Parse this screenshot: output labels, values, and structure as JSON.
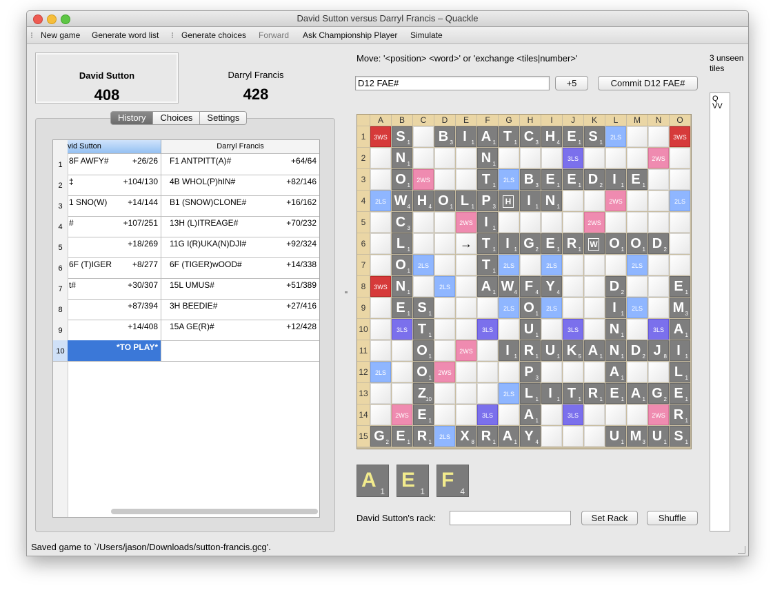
{
  "window": {
    "title": "David Sutton versus Darryl Francis – Quackle"
  },
  "toolbar": {
    "new_game": "New game",
    "generate_word_list": "Generate word list",
    "generate_choices": "Generate choices",
    "forward": "Forward",
    "ask_championship": "Ask Championship Player",
    "simulate": "Simulate"
  },
  "players": [
    {
      "name": "David Sutton",
      "score": "408"
    },
    {
      "name": "Darryl Francis",
      "score": "428"
    }
  ],
  "tabs": [
    "History",
    "Choices",
    "Settings"
  ],
  "history": {
    "columns": [
      "vid Sutton",
      "Darryl Francis"
    ],
    "rows": [
      {
        "n": "1",
        "a_move": "8F AWFY#",
        "a_score": "+26/26",
        "b_move": "F1 ANTPITT(A)#",
        "b_score": "+64/64"
      },
      {
        "n": "2",
        "a_move": "‡",
        "a_score": "+104/130",
        "b_move": "4B WHOL(P)hIN#",
        "b_score": "+82/146"
      },
      {
        "n": "3",
        "a_move": "1 SNO(W)",
        "a_score": "+14/144",
        "b_move": "B1 (SNOW)CLONE#",
        "b_score": "+16/162"
      },
      {
        "n": "4",
        "a_move": "#",
        "a_score": "+107/251",
        "b_move": "13H (L)ITREAGE#",
        "b_score": "+70/232"
      },
      {
        "n": "5",
        "a_move": "",
        "a_score": "+18/269",
        "b_move": "11G I(R)UKA(N)DJI#",
        "b_score": "+92/324"
      },
      {
        "n": "6",
        "a_move": "6F (T)IGER",
        "a_score": "+8/277",
        "b_move": "6F (TIGER)wOOD#",
        "b_score": "+14/338"
      },
      {
        "n": "7",
        "a_move": "t#",
        "a_score": "+30/307",
        "b_move": "15L UMUS#",
        "b_score": "+51/389"
      },
      {
        "n": "8",
        "a_move": "",
        "a_score": "+87/394",
        "b_move": "3H BEEDIE#",
        "b_score": "+27/416"
      },
      {
        "n": "9",
        "a_move": "",
        "a_score": "+14/408",
        "b_move": "15A GE(R)#",
        "b_score": "+12/428"
      }
    ],
    "to_play": {
      "n": "10",
      "label": "*TO PLAY*"
    }
  },
  "move": {
    "label": "Move: '<position> <word>' or 'exchange <tiles|number>'",
    "value": "D12 FAE#",
    "score_button": "+5",
    "commit_button": "Commit D12 FAE#"
  },
  "board": {
    "cols": [
      "A",
      "B",
      "C",
      "D",
      "E",
      "F",
      "G",
      "H",
      "I",
      "J",
      "K",
      "L",
      "M",
      "N",
      "O"
    ],
    "rows": [
      "1",
      "2",
      "3",
      "4",
      "5",
      "6",
      "7",
      "8",
      "9",
      "10",
      "11",
      "12",
      "13",
      "14",
      "15"
    ],
    "premium_labels": {
      "tw": "3WS",
      "dw": "2WS",
      "tl": "3LS",
      "dl": "2LS"
    },
    "premiums": [
      {
        "sq": "A1",
        "t": "tw"
      },
      {
        "sq": "L1",
        "t": "dl"
      },
      {
        "sq": "O1",
        "t": "tw"
      },
      {
        "sq": "J2",
        "t": "tl"
      },
      {
        "sq": "N2",
        "t": "dw"
      },
      {
        "sq": "C3",
        "t": "dw"
      },
      {
        "sq": "G3",
        "t": "dl"
      },
      {
        "sq": "A4",
        "t": "dl"
      },
      {
        "sq": "L4",
        "t": "dw"
      },
      {
        "sq": "O4",
        "t": "dl"
      },
      {
        "sq": "E5",
        "t": "dw"
      },
      {
        "sq": "K5",
        "t": "dw"
      },
      {
        "sq": "C7",
        "t": "dl"
      },
      {
        "sq": "G7",
        "t": "dl"
      },
      {
        "sq": "I7",
        "t": "dl"
      },
      {
        "sq": "M7",
        "t": "dl"
      },
      {
        "sq": "A8",
        "t": "tw"
      },
      {
        "sq": "D8",
        "t": "dl"
      },
      {
        "sq": "G9",
        "t": "dl"
      },
      {
        "sq": "I9",
        "t": "dl"
      },
      {
        "sq": "M9",
        "t": "dl"
      },
      {
        "sq": "B10",
        "t": "tl"
      },
      {
        "sq": "F10",
        "t": "tl"
      },
      {
        "sq": "J10",
        "t": "tl"
      },
      {
        "sq": "N10",
        "t": "tl"
      },
      {
        "sq": "E11",
        "t": "dw"
      },
      {
        "sq": "A12",
        "t": "dl"
      },
      {
        "sq": "D12",
        "t": "dw"
      },
      {
        "sq": "G13",
        "t": "dl"
      },
      {
        "sq": "B14",
        "t": "dw"
      },
      {
        "sq": "F14",
        "t": "tl"
      },
      {
        "sq": "J14",
        "t": "tl"
      },
      {
        "sq": "N14",
        "t": "dw"
      },
      {
        "sq": "D15",
        "t": "dl"
      }
    ],
    "tiles": [
      {
        "sq": "B1",
        "l": "S",
        "p": "1"
      },
      {
        "sq": "D1",
        "l": "B",
        "p": "3"
      },
      {
        "sq": "E1",
        "l": "I",
        "p": "1"
      },
      {
        "sq": "F1",
        "l": "A",
        "p": "1"
      },
      {
        "sq": "G1",
        "l": "T",
        "p": "1"
      },
      {
        "sq": "H1",
        "l": "C",
        "p": "3"
      },
      {
        "sq": "I1",
        "l": "H",
        "p": "4"
      },
      {
        "sq": "J1",
        "l": "E",
        "p": "1"
      },
      {
        "sq": "K1",
        "l": "S",
        "p": "1"
      },
      {
        "sq": "B2",
        "l": "N",
        "p": "1"
      },
      {
        "sq": "F2",
        "l": "N",
        "p": "1"
      },
      {
        "sq": "B3",
        "l": "O",
        "p": "1"
      },
      {
        "sq": "F3",
        "l": "T",
        "p": "1"
      },
      {
        "sq": "H3",
        "l": "B",
        "p": "3"
      },
      {
        "sq": "I3",
        "l": "E",
        "p": "1"
      },
      {
        "sq": "J3",
        "l": "E",
        "p": "1"
      },
      {
        "sq": "K3",
        "l": "D",
        "p": "2"
      },
      {
        "sq": "L3",
        "l": "I",
        "p": "1"
      },
      {
        "sq": "M3",
        "l": "E",
        "p": "1"
      },
      {
        "sq": "B4",
        "l": "W",
        "p": "4"
      },
      {
        "sq": "C4",
        "l": "H",
        "p": "4"
      },
      {
        "sq": "D4",
        "l": "O",
        "p": "1"
      },
      {
        "sq": "E4",
        "l": "L",
        "p": "1"
      },
      {
        "sq": "F4",
        "l": "P",
        "p": "3"
      },
      {
        "sq": "G4",
        "l": "H",
        "p": "",
        "blank": true
      },
      {
        "sq": "H4",
        "l": "I",
        "p": "1"
      },
      {
        "sq": "I4",
        "l": "N",
        "p": "1"
      },
      {
        "sq": "B5",
        "l": "C",
        "p": "3"
      },
      {
        "sq": "F5",
        "l": "I",
        "p": "1"
      },
      {
        "sq": "B6",
        "l": "L",
        "p": "1"
      },
      {
        "sq": "F6",
        "l": "T",
        "p": "1"
      },
      {
        "sq": "G6",
        "l": "I",
        "p": "1"
      },
      {
        "sq": "H6",
        "l": "G",
        "p": "2"
      },
      {
        "sq": "I6",
        "l": "E",
        "p": "1"
      },
      {
        "sq": "J6",
        "l": "R",
        "p": "1"
      },
      {
        "sq": "K6",
        "l": "W",
        "p": "",
        "blank": true
      },
      {
        "sq": "L6",
        "l": "O",
        "p": "1"
      },
      {
        "sq": "M6",
        "l": "O",
        "p": "1"
      },
      {
        "sq": "N6",
        "l": "D",
        "p": "2"
      },
      {
        "sq": "B7",
        "l": "O",
        "p": "1"
      },
      {
        "sq": "F7",
        "l": "T",
        "p": "1"
      },
      {
        "sq": "B8",
        "l": "N",
        "p": "1"
      },
      {
        "sq": "F8",
        "l": "A",
        "p": "1"
      },
      {
        "sq": "G8",
        "l": "W",
        "p": "4"
      },
      {
        "sq": "H8",
        "l": "F",
        "p": "4"
      },
      {
        "sq": "I8",
        "l": "Y",
        "p": "4"
      },
      {
        "sq": "L8",
        "l": "D",
        "p": "2"
      },
      {
        "sq": "O8",
        "l": "E",
        "p": "1"
      },
      {
        "sq": "B9",
        "l": "E",
        "p": "1"
      },
      {
        "sq": "C9",
        "l": "S",
        "p": "1"
      },
      {
        "sq": "H9",
        "l": "O",
        "p": "1"
      },
      {
        "sq": "L9",
        "l": "I",
        "p": "1"
      },
      {
        "sq": "O9",
        "l": "M",
        "p": "3"
      },
      {
        "sq": "C10",
        "l": "T",
        "p": "1"
      },
      {
        "sq": "H10",
        "l": "U",
        "p": "1"
      },
      {
        "sq": "L10",
        "l": "N",
        "p": "1"
      },
      {
        "sq": "O10",
        "l": "A",
        "p": "1"
      },
      {
        "sq": "C11",
        "l": "O",
        "p": "1"
      },
      {
        "sq": "G11",
        "l": "I",
        "p": "1"
      },
      {
        "sq": "H11",
        "l": "R",
        "p": "1"
      },
      {
        "sq": "I11",
        "l": "U",
        "p": "1"
      },
      {
        "sq": "J11",
        "l": "K",
        "p": "5"
      },
      {
        "sq": "K11",
        "l": "A",
        "p": "1"
      },
      {
        "sq": "L11",
        "l": "N",
        "p": "1"
      },
      {
        "sq": "M11",
        "l": "D",
        "p": "2"
      },
      {
        "sq": "N11",
        "l": "J",
        "p": "8"
      },
      {
        "sq": "O11",
        "l": "I",
        "p": "1"
      },
      {
        "sq": "C12",
        "l": "O",
        "p": "1"
      },
      {
        "sq": "H12",
        "l": "P",
        "p": "3"
      },
      {
        "sq": "L12",
        "l": "A",
        "p": "1"
      },
      {
        "sq": "O12",
        "l": "L",
        "p": "1"
      },
      {
        "sq": "C13",
        "l": "Z",
        "p": "10"
      },
      {
        "sq": "H13",
        "l": "L",
        "p": "1"
      },
      {
        "sq": "I13",
        "l": "I",
        "p": "1"
      },
      {
        "sq": "J13",
        "l": "T",
        "p": "1"
      },
      {
        "sq": "K13",
        "l": "R",
        "p": "1"
      },
      {
        "sq": "L13",
        "l": "E",
        "p": "1"
      },
      {
        "sq": "M13",
        "l": "A",
        "p": "1"
      },
      {
        "sq": "N13",
        "l": "G",
        "p": "2"
      },
      {
        "sq": "O13",
        "l": "E",
        "p": "1"
      },
      {
        "sq": "C14",
        "l": "E",
        "p": "1"
      },
      {
        "sq": "H14",
        "l": "A",
        "p": "1"
      },
      {
        "sq": "O14",
        "l": "R",
        "p": "1"
      },
      {
        "sq": "A15",
        "l": "G",
        "p": "2"
      },
      {
        "sq": "B15",
        "l": "E",
        "p": "1"
      },
      {
        "sq": "C15",
        "l": "R",
        "p": "1"
      },
      {
        "sq": "E15",
        "l": "X",
        "p": "8"
      },
      {
        "sq": "F15",
        "l": "R",
        "p": "1"
      },
      {
        "sq": "G15",
        "l": "A",
        "p": "1"
      },
      {
        "sq": "H15",
        "l": "Y",
        "p": "4"
      },
      {
        "sq": "L15",
        "l": "U",
        "p": "1"
      },
      {
        "sq": "M15",
        "l": "M",
        "p": "3"
      },
      {
        "sq": "N15",
        "l": "U",
        "p": "1"
      },
      {
        "sq": "O15",
        "l": "S",
        "p": "1"
      }
    ],
    "arrow_square": "E6",
    "arrow_glyph": "→"
  },
  "rack": {
    "tiles": [
      {
        "l": "A",
        "p": "1"
      },
      {
        "l": "E",
        "p": "1"
      },
      {
        "l": "F",
        "p": "4"
      }
    ],
    "label": "David Sutton's rack:",
    "value": "",
    "set_rack": "Set Rack",
    "shuffle": "Shuffle"
  },
  "unseen": {
    "label": "3 unseen tiles",
    "tiles": "Q VV"
  },
  "status": "Saved game to `/Users/jason/Downloads/sutton-francis.gcg'."
}
